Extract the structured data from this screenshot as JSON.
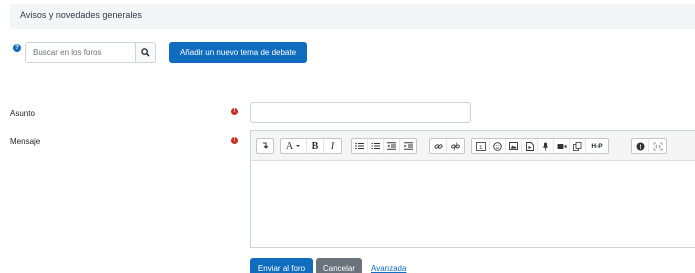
{
  "forum": {
    "title": "Avisos y novedades generales"
  },
  "search": {
    "placeholder": "Buscar en los foros"
  },
  "actions": {
    "add_topic_label": "Añadir un nuevo tema de debate"
  },
  "form": {
    "subject_label": "Asunto",
    "message_label": "Mensaje",
    "subject_value": "",
    "message_value": ""
  },
  "toolbar": {
    "font_glyph": "A",
    "bold_glyph": "B",
    "italic_glyph": "I",
    "h5p_label": "H-P"
  },
  "buttons": {
    "submit_label": "Enviar al foro",
    "cancel_label": "Cancelar",
    "advanced_label": "Avanzada"
  },
  "colors": {
    "primary": "#0f6cbf",
    "secondary": "#6a737b",
    "required": "#ca3120",
    "header_bg": "#f4f5f7"
  }
}
